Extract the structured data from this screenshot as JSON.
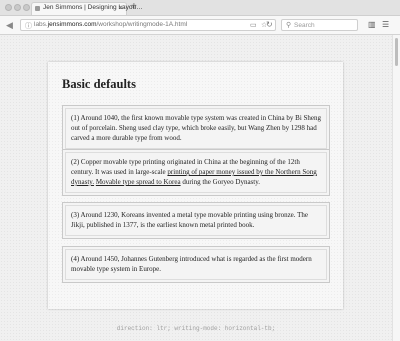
{
  "browser": {
    "tab_title": "Jen Simmons | Designing Layou…",
    "tab_close": "×",
    "new_tab": "+",
    "url_prefix": "labs.",
    "url_domain": "jensimmons.com",
    "url_path": "/workshop/writingmode-1A.html",
    "search_placeholder": "Search",
    "icons": [
      "back-arrow-icon",
      "info-icon",
      "reader-icon",
      "bookmark-icon",
      "reload-icon",
      "search-icon",
      "sidebar-icon",
      "menu-icon"
    ]
  },
  "page": {
    "title": "Basic defaults",
    "paragraphs": [
      {
        "text": "(1) Around 1040, the first known movable type system was created in China by Bi Sheng out of porcelain. Sheng used clay type, which broke easily, but Wang Zhen by 1298 had carved a more durable type from wood."
      },
      {
        "before": "(2) Copper movable type printing originated in China at the beginning of the 12th century. It was used in large-scale ",
        "link1": "printing of paper money issued by the Northern Song dynasty.",
        "link2": "Movable type spread to Korea",
        "after": " during the Goryeo Dynasty."
      },
      {
        "text": "(3) Around 1230, Koreans invented a metal type movable printing using bronze. The Jikji, published in 1377, is the earliest known metal printed book."
      },
      {
        "text": "(4) Around 1450, Johannes Gutenberg introduced what is regarded as the first modern movable type system in Europe."
      }
    ],
    "footer_note": "direction: ltr; writing-mode: horizontal-tb;"
  }
}
